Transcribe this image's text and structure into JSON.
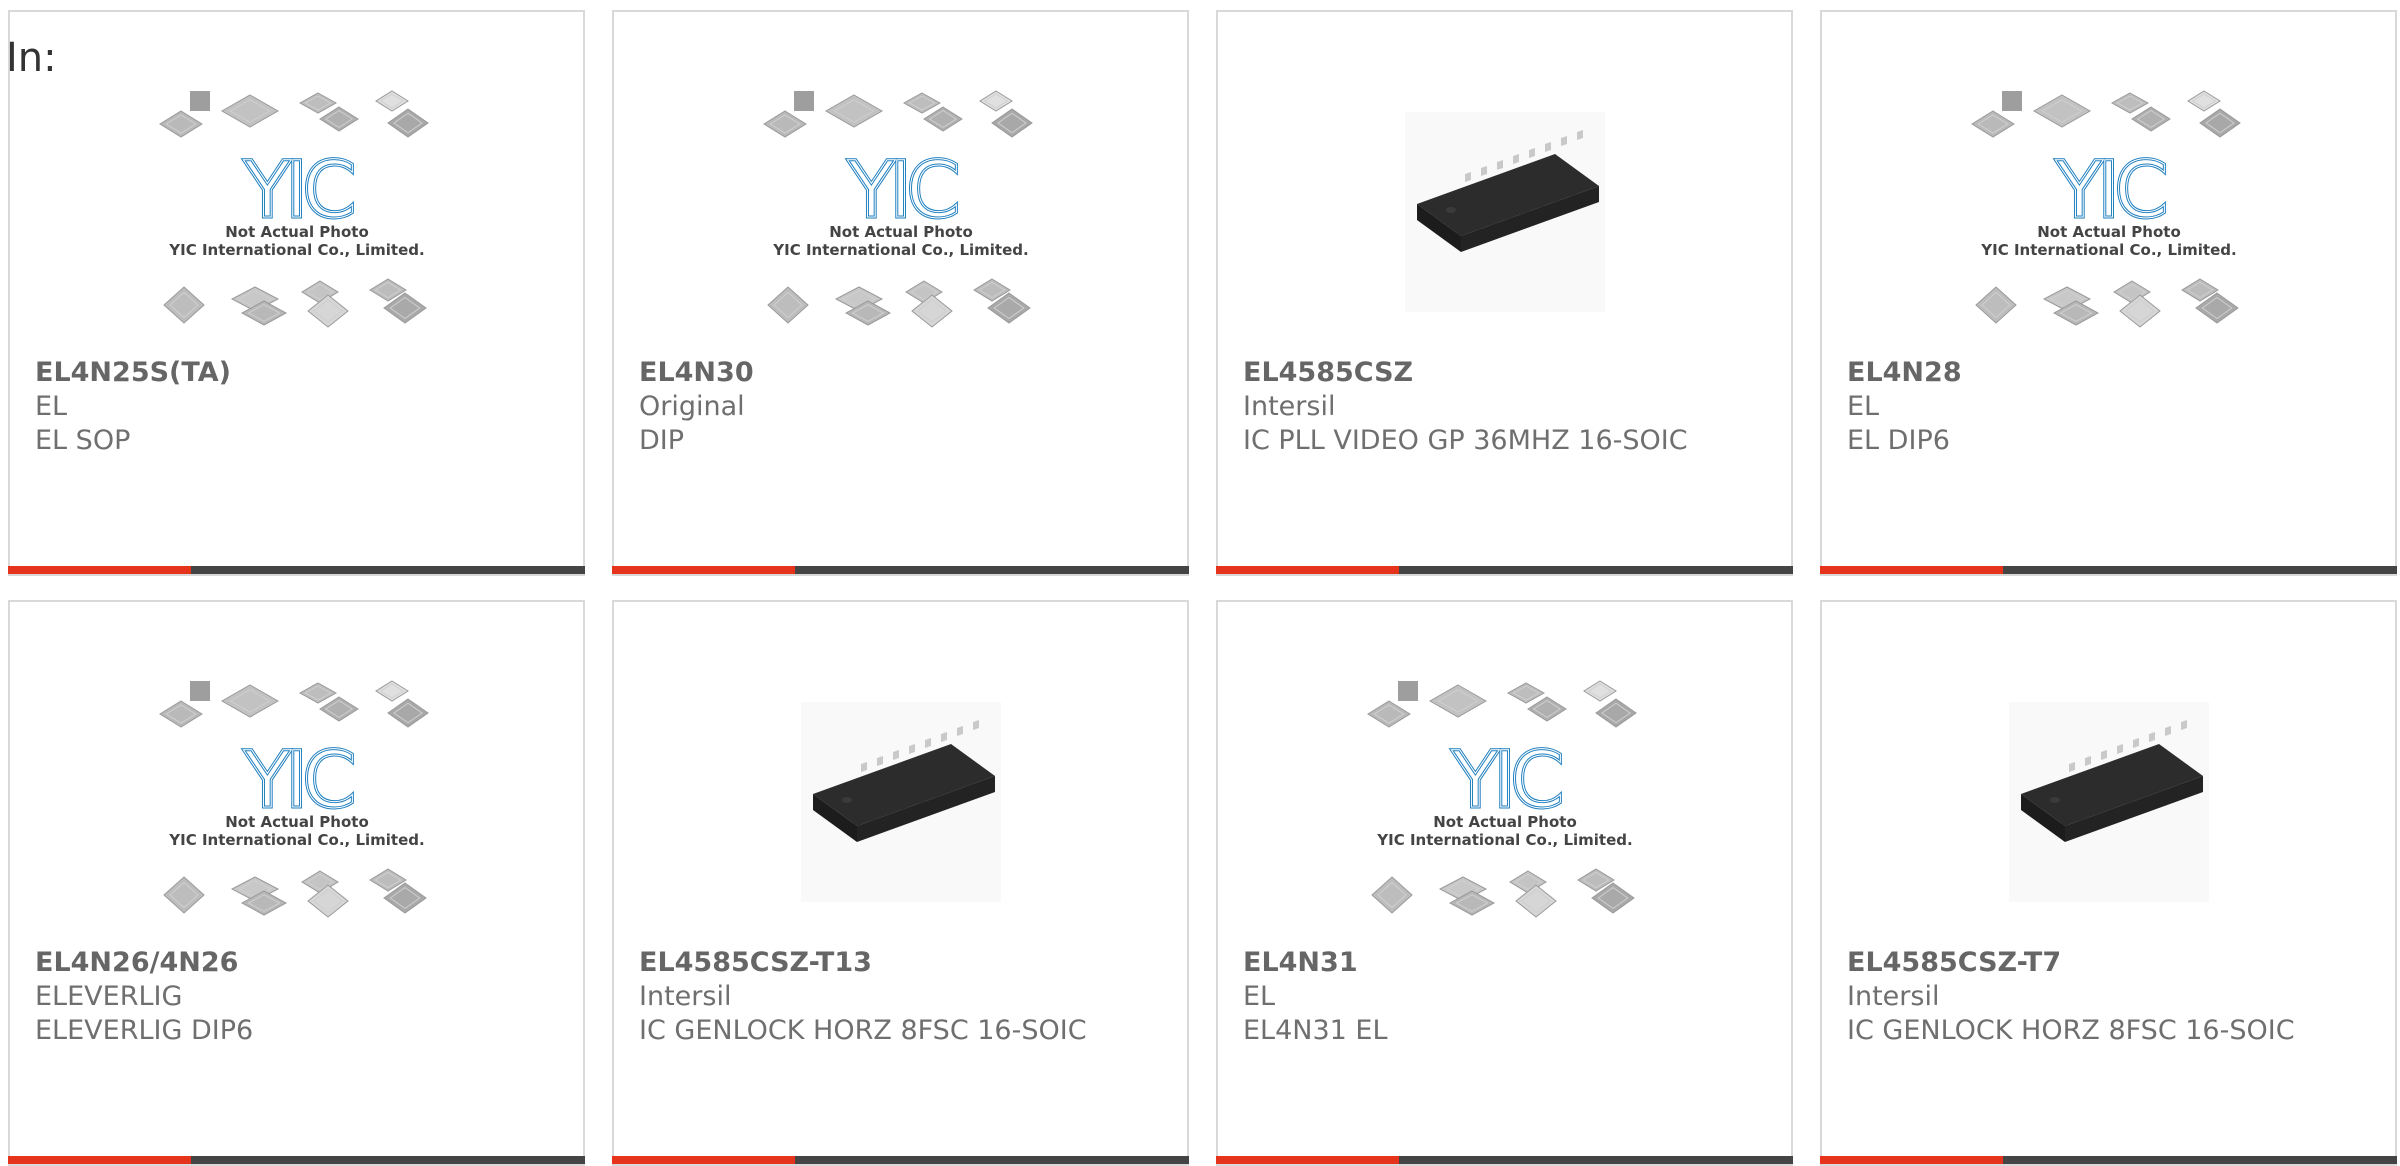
{
  "header": {
    "prefix": "In:"
  },
  "placeholder": {
    "line1": "Not Actual Photo",
    "line2": "YIC International Co., Limited.",
    "logo_text": "YIC"
  },
  "accent_color": "#e5341b",
  "products": [
    {
      "part": "EL4N25S(TA)",
      "brand": "EL",
      "desc": "EL SOP",
      "image": "placeholder-image"
    },
    {
      "part": "EL4N30",
      "brand": "Original",
      "desc": "DIP",
      "image": "placeholder-image"
    },
    {
      "part": "EL4585CSZ",
      "brand": "Intersil",
      "desc": "IC PLL VIDEO GP 36MHZ 16-SOIC",
      "image": "soic-chip-image"
    },
    {
      "part": "EL4N28",
      "brand": "EL",
      "desc": "EL DIP6",
      "image": "placeholder-image"
    },
    {
      "part": "EL4N26/4N26",
      "brand": "ELEVERLIG",
      "desc": "ELEVERLIG DIP6",
      "image": "placeholder-image"
    },
    {
      "part": "EL4585CSZ-T13",
      "brand": "Intersil",
      "desc": "IC GENLOCK HORZ 8FSC 16-SOIC",
      "image": "soic-chip-image"
    },
    {
      "part": "EL4N31",
      "brand": "EL",
      "desc": "EL4N31 EL",
      "image": "placeholder-image"
    },
    {
      "part": "EL4585CSZ-T7",
      "brand": "Intersil",
      "desc": "IC GENLOCK HORZ 8FSC 16-SOIC",
      "image": "soic-chip-image"
    }
  ]
}
